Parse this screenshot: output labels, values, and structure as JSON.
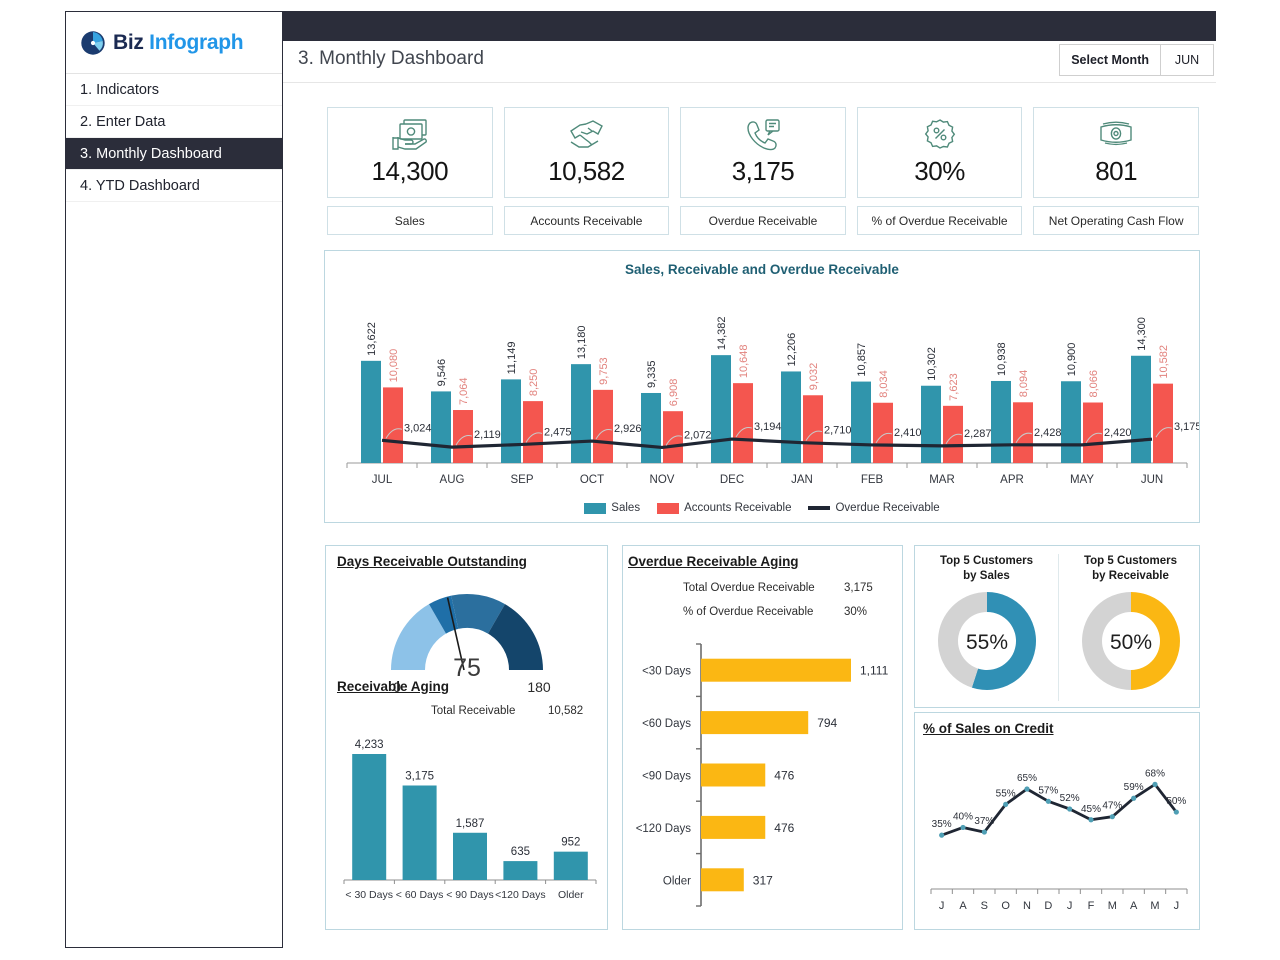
{
  "brand": {
    "name_part1": "Biz",
    "name_part2": "Infograph",
    "logo_icon": "pie-chart-logo-icon"
  },
  "sidebar": {
    "items": [
      {
        "label": "1. Indicators",
        "active": false
      },
      {
        "label": "2. Enter Data",
        "active": false
      },
      {
        "label": "3. Monthly Dashboard",
        "active": true
      },
      {
        "label": "4. YTD Dashboard",
        "active": false
      }
    ]
  },
  "header": {
    "title": "3. Monthly Dashboard",
    "month_selector_label": "Select Month",
    "month_selector_value": "JUN"
  },
  "kpis": [
    {
      "value": "14,300",
      "label": "Sales",
      "icon": "cash-in-hand-icon"
    },
    {
      "value": "10,582",
      "label": "Accounts Receivable",
      "icon": "handshake-money-icon"
    },
    {
      "value": "3,175",
      "label": "Overdue Receivable",
      "icon": "phone-invoice-icon"
    },
    {
      "value": "30%",
      "label": "% of Overdue Receivable",
      "icon": "percent-badge-icon"
    },
    {
      "value": "801",
      "label": "Net Operating Cash Flow",
      "icon": "banknote-icon"
    }
  ],
  "colors": {
    "teal": "#3095ac",
    "coral": "#f4564f",
    "dark_line": "#1f2633",
    "amber": "#fbb713",
    "grey": "#d3d3d3",
    "navy": "#2b2d3a",
    "brand_blue": "#2196e8",
    "title_blue": "#1f5f73"
  },
  "chart_data": [
    {
      "id": "sales-receivable-overdue",
      "type": "bar",
      "title": "Sales, Receivable and Overdue Receivable",
      "categories": [
        "JUL",
        "AUG",
        "SEP",
        "OCT",
        "NOV",
        "DEC",
        "JAN",
        "FEB",
        "MAR",
        "APR",
        "MAY",
        "JUN"
      ],
      "series": [
        {
          "name": "Sales",
          "kind": "bar",
          "color": "#3095ac",
          "values": [
            13622,
            9546,
            11149,
            13180,
            9335,
            14382,
            12206,
            10857,
            10302,
            10938,
            10900,
            14300
          ],
          "labels": [
            "13,622",
            "9,546",
            "11,149",
            "13,180",
            "9,335",
            "14,382",
            "12,206",
            "10,857",
            "10,302",
            "10,938",
            "10,900",
            "14,300"
          ]
        },
        {
          "name": "Accounts Receivable",
          "kind": "bar",
          "color": "#f4564f",
          "values": [
            10080,
            7064,
            8250,
            9753,
            6908,
            10648,
            9032,
            8034,
            7623,
            8094,
            8066,
            10582
          ],
          "labels": [
            "10,080",
            "7,064",
            "8,250",
            "9,753",
            "6,908",
            "10,648",
            "9,032",
            "8,034",
            "7,623",
            "8,094",
            "8,066",
            "10,582"
          ]
        },
        {
          "name": "Overdue Receivable",
          "kind": "line",
          "color": "#1f2633",
          "values": [
            3024,
            2119,
            2475,
            2926,
            2072,
            3194,
            2710,
            2410,
            2287,
            2428,
            2420,
            3175
          ],
          "labels": [
            "3,024",
            "2,119",
            "2,475",
            "2,926",
            "2,072",
            "3,194",
            "2,710",
            "2,410",
            "2,287",
            "2,428",
            "2,420",
            "3,175"
          ]
        }
      ],
      "ylim": [
        0,
        16000
      ],
      "grid": false,
      "legend_position": "bottom"
    },
    {
      "id": "days-receivable-outstanding",
      "type": "gauge",
      "title": "Days Receivable Outstanding",
      "value": 75,
      "value_label": "75",
      "min": 0,
      "max": 180,
      "min_label": "0",
      "max_label": "180",
      "bands": [
        {
          "from": 0,
          "to": 60,
          "color": "#8dc2e8"
        },
        {
          "from": 60,
          "to": 78,
          "color": "#1f6fa8"
        },
        {
          "from": 78,
          "to": 120,
          "color": "#2b6f9e"
        },
        {
          "from": 120,
          "to": 180,
          "color": "#14456b"
        }
      ]
    },
    {
      "id": "receivable-aging",
      "type": "bar",
      "title": "Receivable Aging",
      "total_label": "Total Receivable",
      "total_value": "10,582",
      "categories": [
        "< 30 Days",
        "< 60 Days",
        "< 90 Days",
        "<120 Days",
        "Older"
      ],
      "values": [
        4233,
        3175,
        1587,
        635,
        952
      ],
      "value_labels": [
        "4,233",
        "3,175",
        "1,587",
        "635",
        "952"
      ],
      "color": "#3095ac",
      "ylim": [
        0,
        4233
      ]
    },
    {
      "id": "overdue-receivable-aging",
      "type": "bar",
      "orientation": "horizontal",
      "title": "Overdue Receivable Aging",
      "stats": [
        {
          "label": "Total  Overdue Receivable",
          "value": "3,175"
        },
        {
          "label": "% of Overdue Receivable",
          "value": "30%"
        }
      ],
      "categories": [
        "<30 Days",
        "<60 Days",
        "<90 Days",
        "<120 Days",
        "Older"
      ],
      "values": [
        1111,
        794,
        476,
        476,
        317
      ],
      "value_labels": [
        "1,111",
        "794",
        "476",
        "476",
        "317"
      ],
      "color": "#fbb713",
      "xlim": [
        0,
        1111
      ]
    },
    {
      "id": "top5-customers-by-sales",
      "type": "pie",
      "title_line1": "Top 5 Customers",
      "title_line2": "by Sales",
      "center_label": "55%",
      "values": [
        55,
        45
      ],
      "colors": [
        "#3090b5",
        "#d3d3d3"
      ]
    },
    {
      "id": "top5-customers-by-receivable",
      "type": "pie",
      "title_line1": "Top 5 Customers",
      "title_line2": "by Receivable",
      "center_label": "50%",
      "values": [
        50,
        50
      ],
      "colors": [
        "#fbb713",
        "#d3d3d3"
      ]
    },
    {
      "id": "pct-sales-on-credit",
      "type": "line",
      "title": "% of Sales on Credit",
      "categories": [
        "J",
        "A",
        "S",
        "O",
        "N",
        "D",
        "J",
        "F",
        "M",
        "A",
        "M",
        "J"
      ],
      "values": [
        35,
        40,
        37,
        55,
        65,
        57,
        52,
        45,
        47,
        59,
        68,
        50
      ],
      "value_labels": [
        "35%",
        "40%",
        "37%",
        "55%",
        "65%",
        "57%",
        "52%",
        "45%",
        "47%",
        "59%",
        "68%",
        "50%"
      ],
      "color": "#1f2633",
      "marker_color": "#4f9fb5",
      "ylim": [
        0,
        78
      ]
    }
  ]
}
